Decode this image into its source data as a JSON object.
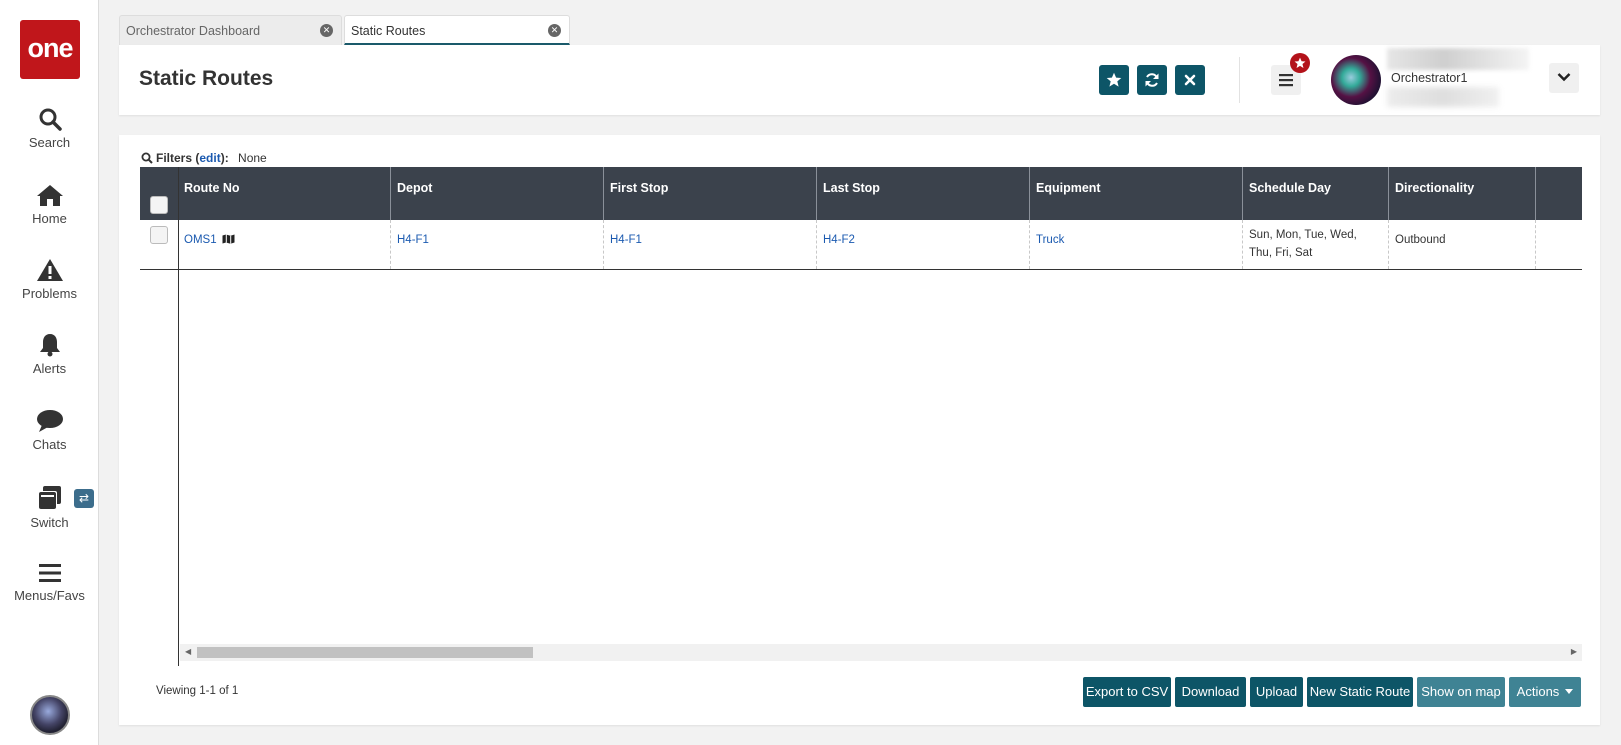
{
  "app": {
    "logo_text": "one"
  },
  "nav": {
    "items": [
      {
        "label": "Search",
        "icon": "search-icon"
      },
      {
        "label": "Home",
        "icon": "home-icon"
      },
      {
        "label": "Problems",
        "icon": "warning-icon"
      },
      {
        "label": "Alerts",
        "icon": "bell-icon"
      },
      {
        "label": "Chats",
        "icon": "chat-icon"
      },
      {
        "label": "Switch",
        "icon": "switch-icon"
      },
      {
        "label": "Menus/Favs",
        "icon": "hamburger-icon"
      }
    ],
    "switch_badge": "⇄"
  },
  "tabs": [
    {
      "label": "Orchestrator Dashboard",
      "active": false
    },
    {
      "label": "Static Routes",
      "active": true
    }
  ],
  "header": {
    "title": "Static Routes",
    "user_name": "Orchestrator1"
  },
  "filters": {
    "label": "Filters",
    "edit": "edit",
    "value": "None"
  },
  "table": {
    "columns": [
      "Route No",
      "Depot",
      "First Stop",
      "Last Stop",
      "Equipment",
      "Schedule Day",
      "Directionality"
    ],
    "rows": [
      {
        "route_no": "OMS1",
        "depot": "H4-F1",
        "first_stop": "H4-F1",
        "last_stop": "H4-F2",
        "equipment": "Truck",
        "schedule_day": "Sun, Mon, Tue, Wed, Thu, Fri, Sat",
        "directionality": "Outbound"
      }
    ]
  },
  "footer": {
    "viewing": "Viewing 1-1 of 1",
    "buttons": {
      "export_csv": "Export to CSV",
      "download": "Download",
      "upload": "Upload",
      "new_static_route": "New Static Route",
      "show_on_map": "Show on map",
      "actions": "Actions"
    }
  },
  "colors": {
    "brand_red": "#c0161b",
    "button_teal": "#0d5567",
    "link_blue": "#1b5ab0",
    "grid_header": "#3b424c"
  }
}
